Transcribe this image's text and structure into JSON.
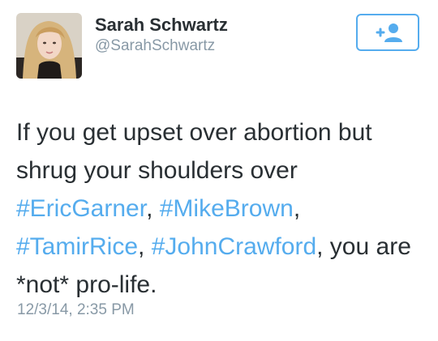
{
  "author": {
    "name": "Sarah Schwartz",
    "handle": "@SarahSchwartz",
    "avatar_icon": "profile-photo"
  },
  "follow_button": {
    "icon": "add-user-icon",
    "accent_color": "#55acee"
  },
  "tweet": {
    "segments": [
      {
        "type": "text",
        "value": "If you get upset over abortion but shrug your shoulders over "
      },
      {
        "type": "hashtag",
        "value": "#EricGarner"
      },
      {
        "type": "text",
        "value": ", "
      },
      {
        "type": "hashtag",
        "value": "#MikeBrown"
      },
      {
        "type": "text",
        "value": ", "
      },
      {
        "type": "hashtag",
        "value": "#TamirRice"
      },
      {
        "type": "text",
        "value": ", "
      },
      {
        "type": "hashtag",
        "value": "#JohnCrawford"
      },
      {
        "type": "text",
        "value": ", you are *not* pro-life."
      }
    ],
    "timestamp": "12/3/14, 2:35 PM"
  },
  "colors": {
    "text": "#292f33",
    "secondary": "#8899a6",
    "link": "#55acee"
  }
}
